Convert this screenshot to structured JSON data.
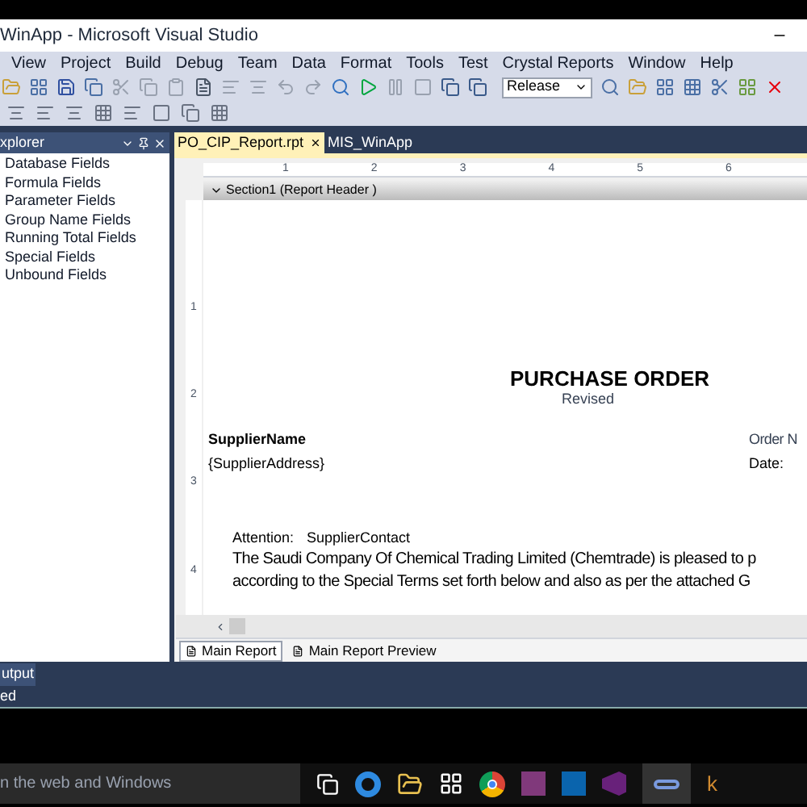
{
  "window": {
    "title": "WinApp - Microsoft Visual Studio"
  },
  "menu": [
    "View",
    "Project",
    "Build",
    "Debug",
    "Team",
    "Data",
    "Format",
    "Tools",
    "Test",
    "Crystal Reports",
    "Window",
    "Help"
  ],
  "toolbar": {
    "configuration": "Release"
  },
  "field_explorer": {
    "title": "xplorer",
    "items": [
      "Database Fields",
      "Formula Fields",
      "Parameter Fields",
      "Group Name Fields",
      "Running Total Fields",
      "Special Fields",
      "Unbound Fields"
    ]
  },
  "document_tabs": [
    {
      "label": "PO_CIP_Report.rpt",
      "selected": true,
      "closable": true
    },
    {
      "label": "MIS_WinApp",
      "selected": false,
      "closable": false
    }
  ],
  "ruler": {
    "marks": [
      "1",
      "2",
      "3",
      "4",
      "5",
      "6"
    ],
    "vertical_marks": [
      "1",
      "2",
      "3",
      "4"
    ]
  },
  "section": {
    "title": "Section1 (Report Header )"
  },
  "report_objects": [
    {
      "kind": "title",
      "text": "PURCHASE ORDER"
    },
    {
      "kind": "subtitle",
      "text": "Revised"
    },
    {
      "kind": "bold",
      "text": "SupplierName"
    },
    {
      "kind": "plain",
      "text": "{SupplierAddress}"
    },
    {
      "kind": "right",
      "text": "Order N"
    },
    {
      "kind": "right2",
      "text": "Date:"
    },
    {
      "kind": "attention",
      "text": "Attention:"
    },
    {
      "kind": "contact",
      "text": "SupplierContact"
    },
    {
      "kind": "paragraph",
      "text": "The Saudi Company Of Chemical Trading Limited (Chemtrade) is pleased to p"
    },
    {
      "kind": "paragraph2",
      "text": "according to the Special Terms set forth below and also as per the attached G"
    }
  ],
  "view_tabs": [
    {
      "label": "Main Report",
      "selected": true
    },
    {
      "label": "Main Report Preview",
      "selected": false
    }
  ],
  "output_tab": "utput",
  "status_bar": "ed",
  "taskbar": {
    "search_placeholder": "n the web and Windows",
    "last_app_letter": "k"
  }
}
